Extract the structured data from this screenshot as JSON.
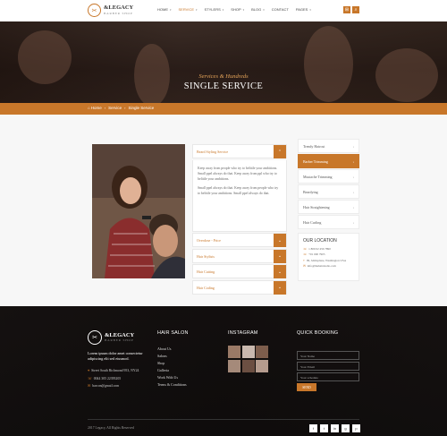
{
  "brand": {
    "name": "&LEGACY",
    "tagline": "BARBER SHOP"
  },
  "nav": [
    {
      "label": "HOME",
      "caret": "▾"
    },
    {
      "label": "SERVICE",
      "caret": "▾",
      "active": true
    },
    {
      "label": "STYLERS",
      "caret": "▾"
    },
    {
      "label": "SHOP",
      "caret": "▾"
    },
    {
      "label": "BLOG",
      "caret": "▾"
    },
    {
      "label": "CONTACT",
      "caret": ""
    },
    {
      "label": "PAGES",
      "caret": "▾"
    }
  ],
  "hero": {
    "subtitle": "Services & Hundreds",
    "title": "SINGLE SERVICE"
  },
  "breadcrumb": {
    "home": "Home",
    "service": "Service",
    "current": "Single Service"
  },
  "accordion": {
    "open_title": "Beard Styling Service",
    "open_paragraph_1": "Keep away from people who try to belittle your ambitions. Small ppel always do that. Keep away from ppl who try to belittle your ambitions.",
    "open_paragraph_2": "Small ppel always do that. Keep away from people who try to belittle your ambitions. Small ppel always do that.",
    "items": [
      "Overdose - Price",
      "Hair Stylists",
      "Hair Cutting",
      "Hair Coding"
    ]
  },
  "sidebar": {
    "items": [
      "Trendy Haircut",
      "Barber Trimming",
      "Mustache Trimming",
      "Beardying",
      "Hair Straightening",
      "Hair Curling"
    ],
    "active_index": 1,
    "location_title": "OUR LOCATION",
    "location": {
      "phone": "1 800 02 456 7890",
      "phone_alt": "+01 000 7905",
      "address": "09, Jelmsplane, Washington USA",
      "email": "info@thehairstudio.com"
    }
  },
  "footer": {
    "about": "Lorem ipsum dolor amet consectetur adipiscing elit sed eiusmod.",
    "address": "Street South Richmond 953, NY24",
    "phone": "0044 305 22395205",
    "email": "barcon@gmail.com",
    "hair_salon_title": "HAIR SALON",
    "links": [
      "About Us",
      "Salons",
      "Shop",
      "Galleria",
      "Work With Us",
      "Terms & Conditions"
    ],
    "instagram_title": "INSTAGRAM",
    "booking_title": "QUICK BOOKING",
    "form": {
      "name_placeholder": "Your Name",
      "email_placeholder": "Your Email",
      "schedule_placeholder": "Your schedule",
      "send": "SEND"
    },
    "copyright": "2017 Legacy, All Rights Reserved",
    "social": [
      "f",
      "t",
      "in",
      "g",
      "p"
    ]
  },
  "icons": {
    "cart": "cart-icon",
    "search": "search-icon",
    "home": "home-icon",
    "plus": "plus-icon",
    "chevron": "chevron-down-icon",
    "arrow": "chevron-right-icon"
  },
  "colors": {
    "accent": "#c8772a",
    "footer_bg": "#141111",
    "hero_overlay": "#2b1d17"
  }
}
